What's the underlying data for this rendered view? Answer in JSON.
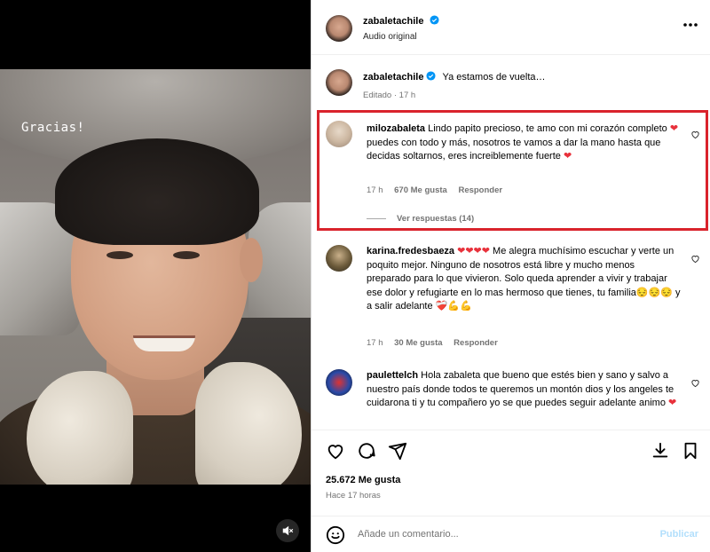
{
  "media": {
    "overlay_text": "Gracias!",
    "mute_icon": "speaker-muted-icon"
  },
  "post": {
    "username": "zabaletachile",
    "subtitle": "Audio original",
    "caption_text": "Ya estamos de vuelta…",
    "caption_meta": "Editado · 17 h"
  },
  "comments": [
    {
      "username": "milozabaleta",
      "text_parts": [
        "Lindo papito precioso, te amo con mi corazón completo ",
        "❤",
        " puedes con todo y más, nosotros te vamos a dar la mano hasta que decidas soltarnos, eres increiblemente fuerte ",
        "❤"
      ],
      "time": "17 h",
      "likes": "670 Me gusta",
      "reply": "Responder",
      "view_replies": "Ver respuestas (14)"
    },
    {
      "username": "karina.fredesbaeza",
      "text_parts": [
        "❤❤❤❤",
        " Me alegra muchísimo escuchar y verte un poquito mejor. Ninguno de nosotros está libre y mucho menos preparado para lo que vivieron. Solo queda aprender a vivir y trabajar ese dolor y refugiarte en lo mas hermoso que tienes, tu familia",
        "😔😔😔",
        " y a salir adelante ",
        "❤‍🩹💪💪"
      ],
      "time": "17 h",
      "likes": "30 Me gusta",
      "reply": "Responder"
    },
    {
      "username": "paulettelch",
      "text_parts": [
        "Hola zabaleta que bueno que estés bien y sano y salvo a nuestro país donde todos te queremos un montón dios y los angeles te cuidarona ti y tu compañero yo se que puedes seguir adelante animo ",
        "❤"
      ]
    }
  ],
  "footer": {
    "likes": "25.672 Me gusta",
    "time": "Hace 17 horas",
    "comment_placeholder": "Añade un comentario...",
    "post_label": "Publicar"
  },
  "colors": {
    "highlight": "#d9232c",
    "verified": "#0095f6",
    "link_disabled": "#b2dffc"
  }
}
